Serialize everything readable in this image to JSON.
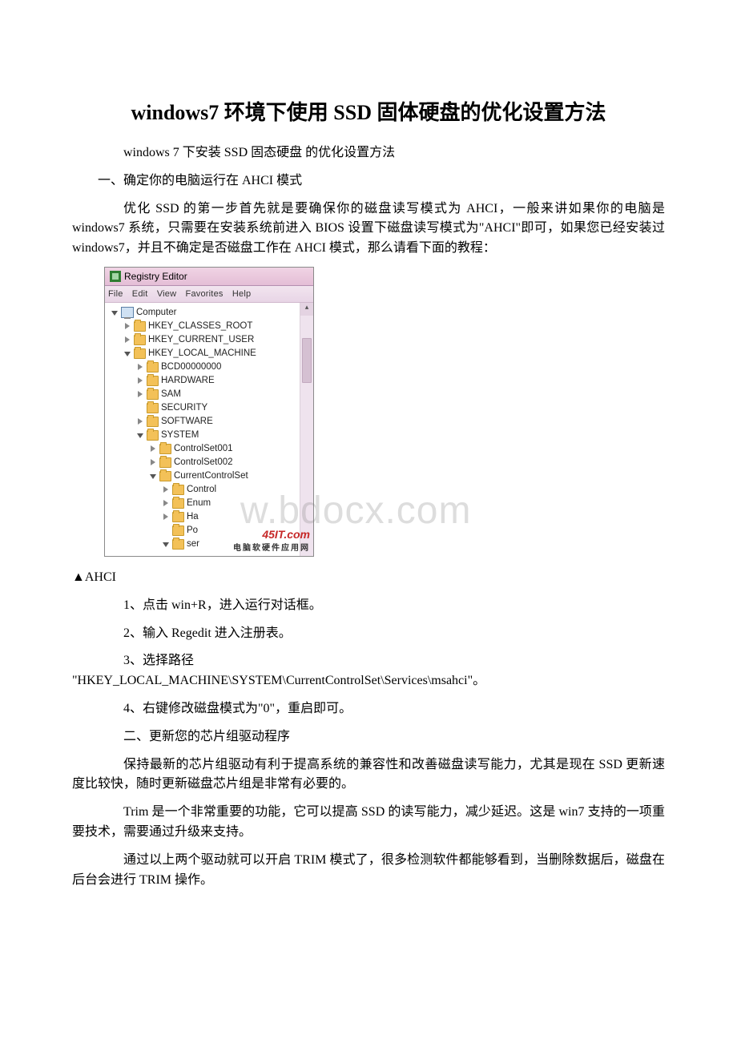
{
  "title": "windows7 环境下使用 SSD 固体硬盘的优化设置方法",
  "p_intro": "windows 7 下安装 SSD 固态硬盘 的优化设置方法",
  "p_sec1": "一、确定你的电脑运行在 AHCI 模式",
  "p_sec1_body": "优化 SSD 的第一步首先就是要确保你的磁盘读写模式为 AHCI，一般来讲如果你的电脑是 windows7 系统，只需要在安装系统前进入 BIOS 设置下磁盘读写模式为\"AHCI\"即可，如果您已经安装过 windows7，并且不确定是否磁盘工作在 AHCI 模式，那么请看下面的教程：",
  "caption_ahci": "▲AHCI",
  "step1": "1、点击 win+R，进入运行对话框。",
  "step2": "2、输入 Regedit 进入注册表。",
  "step3_a": "3、选择路径",
  "step3_b": "\"HKEY_LOCAL_MACHINE\\SYSTEM\\CurrentControlSet\\Services\\msahci\"。",
  "step4": "4、右键修改磁盘模式为\"0\"，重启即可。",
  "p_sec2": "二、更新您的芯片组驱动程序",
  "p_sec2_body1": "保持最新的芯片组驱动有利于提高系统的兼容性和改善磁盘读写能力，尤其是现在 SSD 更新速度比较快，随时更新磁盘芯片组是非常有必要的。",
  "p_sec2_body2": "Trim 是一个非常重要的功能，它可以提高 SSD 的读写能力，减少延迟。这是 win7 支持的一项重要技术，需要通过升级来支持。",
  "p_sec2_body3": "通过以上两个驱动就可以开启 TRIM 模式了，很多检测软件都能够看到，当删除数据后，磁盘在后台会进行 TRIM 操作。",
  "regedit": {
    "title": "Registry Editor",
    "menu": {
      "file": "File",
      "edit": "Edit",
      "view": "View",
      "fav": "Favorites",
      "help": "Help"
    },
    "nodes": {
      "computer": "Computer",
      "hkcr": "HKEY_CLASSES_ROOT",
      "hkcu": "HKEY_CURRENT_USER",
      "hklm": "HKEY_LOCAL_MACHINE",
      "bcd": "BCD00000000",
      "hardware": "HARDWARE",
      "sam": "SAM",
      "security": "SECURITY",
      "software": "SOFTWARE",
      "system": "SYSTEM",
      "cs001": "ControlSet001",
      "cs002": "ControlSet002",
      "ccs": "CurrentControlSet",
      "control": "Control",
      "enum": "Enum",
      "ha": "Ha",
      "po": "Po",
      "ser": "ser"
    },
    "logo_brand": "45IT",
    "logo_com": ".com",
    "logo_sub": "电脑软硬件应用网"
  },
  "watermark_site": "w.bdocx.com"
}
